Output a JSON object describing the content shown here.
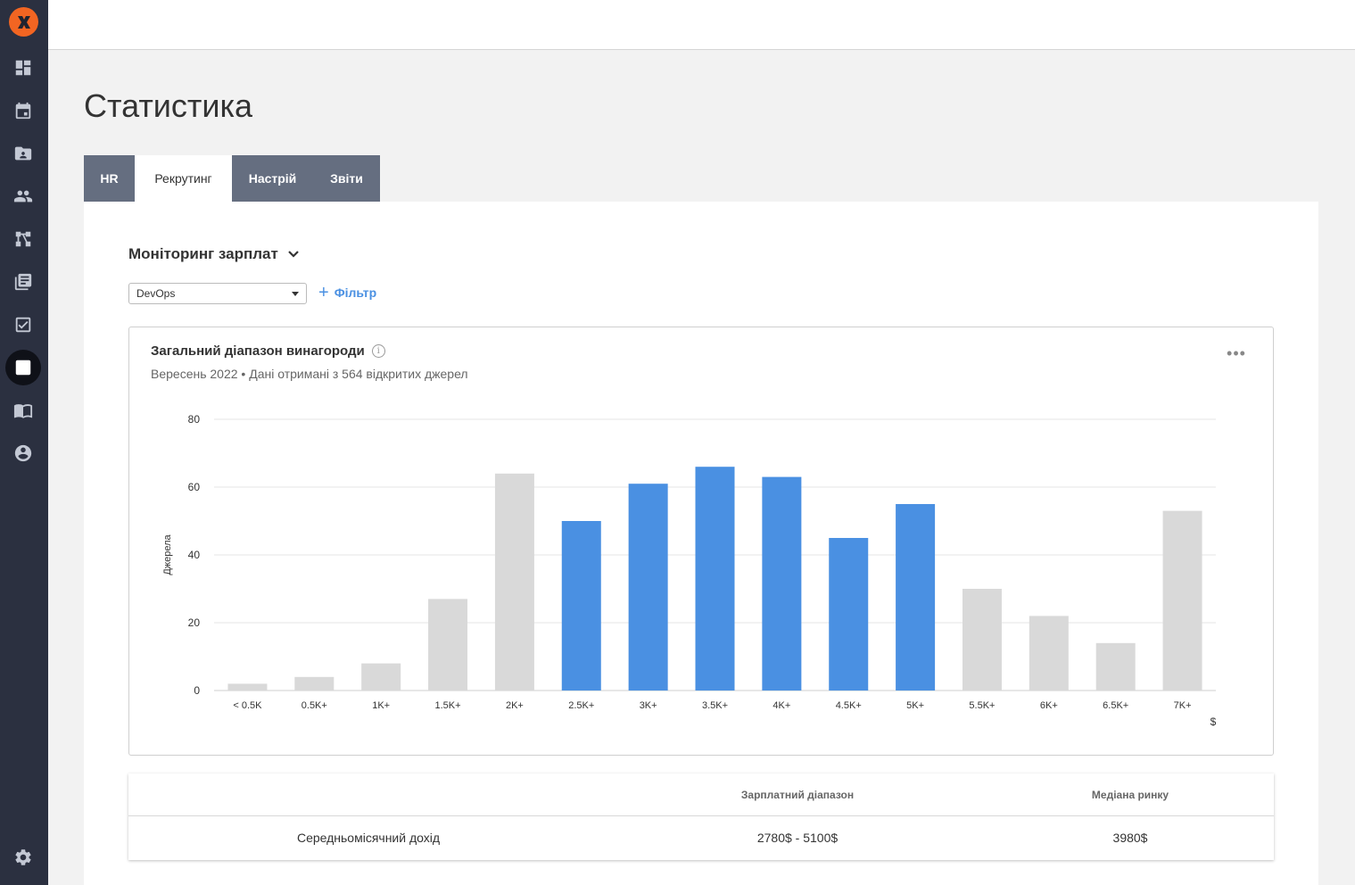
{
  "sidebar": {
    "items": [
      {
        "icon": "dashboard-icon"
      },
      {
        "icon": "calendar-icon"
      },
      {
        "icon": "contacts-folder-icon"
      },
      {
        "icon": "people-icon"
      },
      {
        "icon": "org-structure-icon"
      },
      {
        "icon": "library-icon"
      },
      {
        "icon": "tasks-check-icon"
      },
      {
        "icon": "statistics-icon",
        "active": true
      },
      {
        "icon": "knowledge-book-icon"
      },
      {
        "icon": "profile-icon"
      },
      {
        "icon": "settings-icon"
      }
    ]
  },
  "page": {
    "title": "Статистика"
  },
  "tabs": [
    {
      "label": "HR"
    },
    {
      "label": "Рекрутинг",
      "active": true
    },
    {
      "label": "Настрій"
    },
    {
      "label": "Звіти"
    }
  ],
  "section": {
    "title": "Моніторинг зарплат",
    "select_value": "DevOps",
    "filter_label": "Фільтр"
  },
  "chart_card": {
    "title": "Загальний діапазон винагороди",
    "subtitle": "Вересень 2022 • Дані отримані з 564 відкритих джерел",
    "more_label": "•••"
  },
  "chart_data": {
    "type": "bar",
    "categories": [
      "< 0.5K",
      "0.5K+",
      "1K+",
      "1.5K+",
      "2K+",
      "2.5K+",
      "3K+",
      "3.5K+",
      "4K+",
      "4.5K+",
      "5K+",
      "5.5K+",
      "6K+",
      "6.5K+",
      "7K+"
    ],
    "values": [
      2,
      4,
      8,
      27,
      64,
      50,
      61,
      66,
      63,
      45,
      55,
      30,
      22,
      14,
      53
    ],
    "highlighted": [
      false,
      false,
      false,
      false,
      false,
      true,
      true,
      true,
      true,
      true,
      true,
      false,
      false,
      false,
      false
    ],
    "ylabel": "Джерела",
    "xunit": "$",
    "ylim": [
      0,
      80
    ],
    "yticks": [
      0,
      20,
      40,
      60,
      80
    ],
    "grid": true,
    "colors": {
      "highlight": "#4a90e2",
      "default": "#d9d9d9",
      "grid": "#e6e6e6"
    }
  },
  "summary_table": {
    "headers": [
      "",
      "Зарплатний діапазон",
      "Медіана ринку"
    ],
    "rows": [
      [
        "Середньомісячний дохід",
        "2780$ - 5100$",
        "3980$"
      ]
    ]
  }
}
